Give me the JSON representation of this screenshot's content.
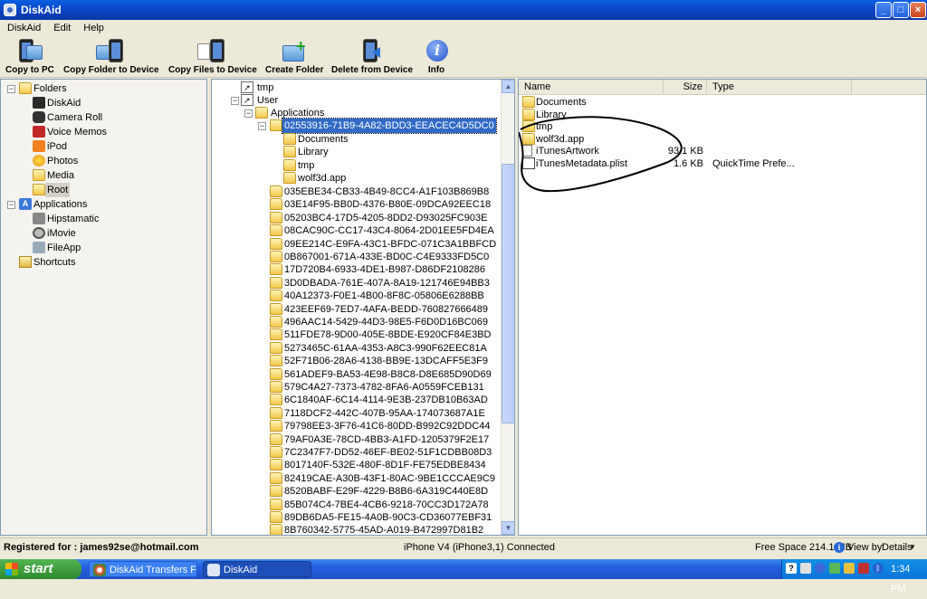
{
  "window": {
    "title": "DiskAid",
    "controls": [
      "_",
      "□",
      "×"
    ]
  },
  "menu": [
    "DiskAid",
    "Edit",
    "Help"
  ],
  "toolbar": {
    "copy_to_pc": "Copy to PC",
    "copy_folder": "Copy Folder to Device",
    "copy_files": "Copy Files to Device",
    "create_folder": "Create Folder",
    "delete": "Delete from Device",
    "info": "Info"
  },
  "sidebar": {
    "folders": "Folders",
    "items": [
      "DiskAid",
      "Camera Roll",
      "Voice Memos",
      "iPod",
      "Photos",
      "Media",
      "Root"
    ],
    "applications": "Applications",
    "apps": [
      "Hipstamatic",
      "iMovie",
      "FileApp"
    ],
    "shortcuts": "Shortcuts"
  },
  "tree": {
    "tmp": "tmp",
    "user": "User",
    "applications": "Applications",
    "selected_app": "02553916-71B9-4A82-BDD3-EEACEC4D5DC0",
    "selected_children": [
      "Documents",
      "Library",
      "tmp",
      "wolf3d.app"
    ],
    "apps": [
      "035EBE34-CB33-4B49-8CC4-A1F103B869B8",
      "03E14F95-BB0D-4376-B80E-09DCA92EEC18",
      "05203BC4-17D5-4205-8DD2-D93025FC903E",
      "08CAC90C-CC17-43C4-8064-2D01EE5FD4EA",
      "09EE214C-E9FA-43C1-BFDC-071C3A1BBFCD",
      "0B867001-671A-433E-BD0C-C4E9333FD5C0",
      "17D720B4-6933-4DE1-B987-D86DF2108286",
      "3D0DBADA-761E-407A-8A19-121746E94BB3",
      "40A12373-F0E1-4B00-8F8C-05806E6288BB",
      "423EEF69-7ED7-4AFA-BEDD-760827666489",
      "496AAC14-5429-44D3-98E5-F6D0D16BC069",
      "511FDE78-9D00-405E-8BDE-E920CF84E3BD",
      "5273465C-61AA-4353-A8C3-990F62EEC81A",
      "52F71B06-28A6-4138-BB9E-13DCAFF5E3F9",
      "561ADEF9-BA53-4E98-B8C8-D8E685D90D69",
      "579C4A27-7373-4782-8FA6-A0559FCEB131",
      "6C1840AF-6C14-4114-9E3B-237DB10B63AD",
      "7118DCF2-442C-407B-95AA-174073687A1E",
      "79798EE3-3F76-41C6-80DD-B992C92DDC44",
      "79AF0A3E-78CD-4BB3-A1FD-1205379F2E17",
      "7C2347F7-DD52-46EF-BE02-51F1CDBB08D3",
      "8017140F-532E-480F-8D1F-FE75EDBE8434",
      "82419CAE-A30B-43F1-80AC-9BE1CCCAE9C9",
      "8520BABF-E29F-4229-B8B6-6A319C440E8D",
      "85B074C4-7BE4-4CB6-9218-70CC3D172A78",
      "89DB6DA5-FE15-4A0B-90C3-CD36077EBF31",
      "8B760342-5775-45AD-A019-B472997D81B2"
    ]
  },
  "details": {
    "columns": {
      "name": "Name",
      "size": "Size",
      "type": "Type"
    },
    "rows": [
      {
        "name": "Documents",
        "size": "",
        "type": "",
        "icon": "folder"
      },
      {
        "name": "Library",
        "size": "",
        "type": "",
        "icon": "folder"
      },
      {
        "name": "tmp",
        "size": "",
        "type": "",
        "icon": "folder"
      },
      {
        "name": "wolf3d.app",
        "size": "",
        "type": "",
        "icon": "folder"
      },
      {
        "name": "iTunesArtwork",
        "size": "93.1 KB",
        "type": "",
        "icon": "file"
      },
      {
        "name": "iTunesMetadata.plist",
        "size": "1.6 KB",
        "type": "QuickTime Prefe...",
        "icon": "plist"
      }
    ]
  },
  "status": {
    "registered": "Registered for : james92se@hotmail.com",
    "device": "iPhone V4 (iPhone3,1) Connected",
    "free_space": "Free Space 214.1 MB",
    "view_by_label": "View by:",
    "view_by_value": "Details"
  },
  "taskbar": {
    "start": "start",
    "tasks": [
      "DiskAid Transfers File...",
      "DiskAid"
    ],
    "clock": "1:34 PM"
  }
}
